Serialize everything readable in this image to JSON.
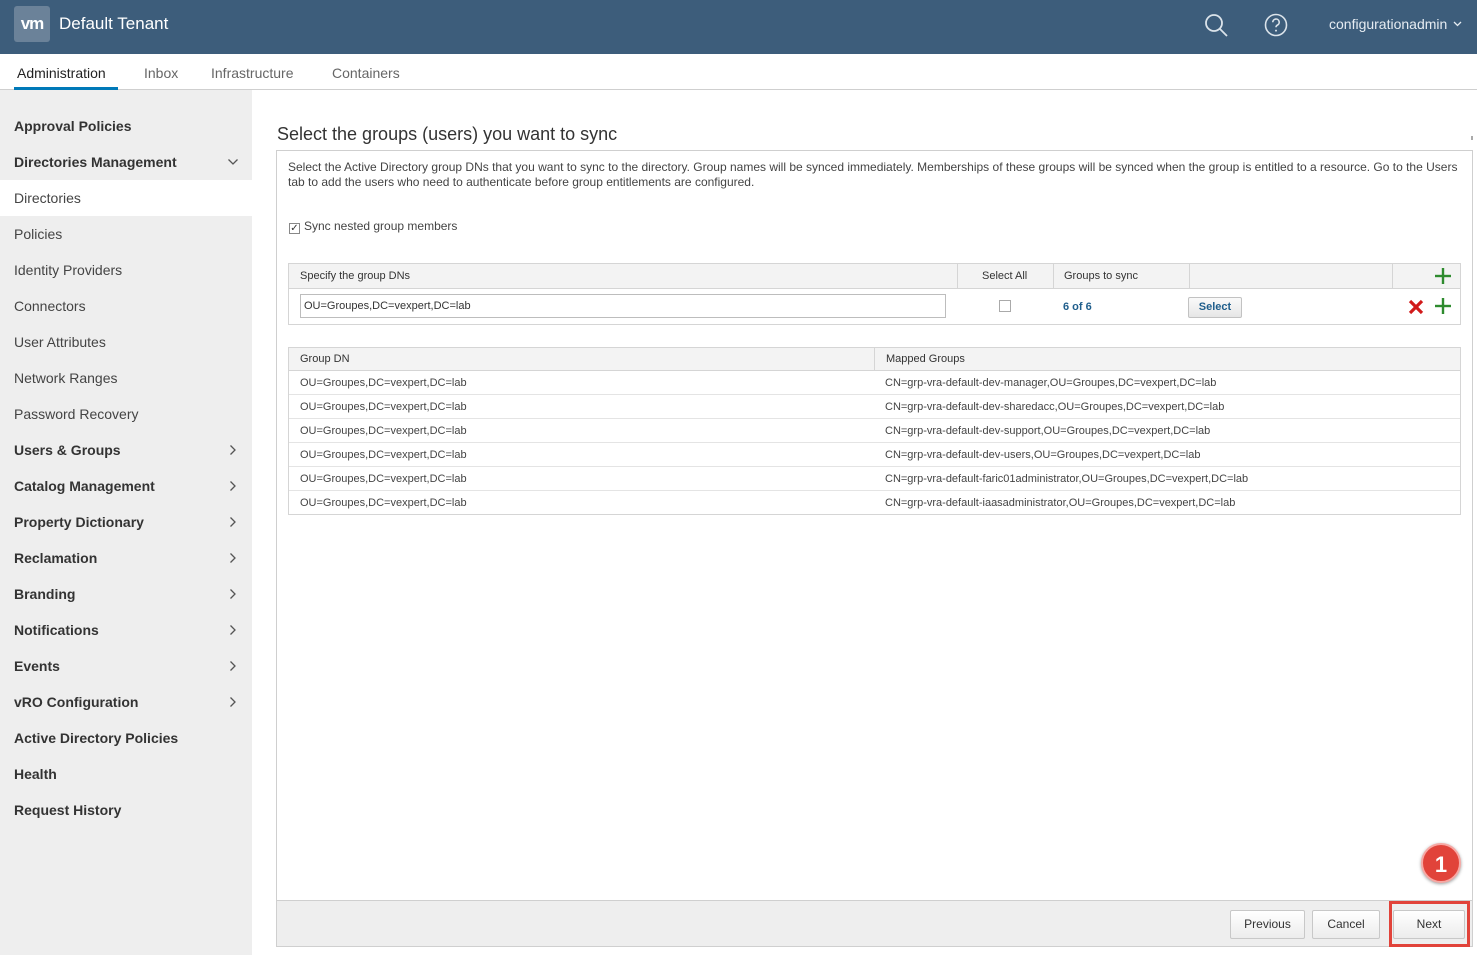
{
  "header": {
    "logo_text": "vm",
    "tenant": "Default Tenant",
    "user": "configurationadmin",
    "icons": [
      "search-icon",
      "help-icon",
      "chevron-down-icon"
    ]
  },
  "tabs": [
    {
      "label": "Administration",
      "active": true
    },
    {
      "label": "Inbox"
    },
    {
      "label": "Infrastructure"
    },
    {
      "label": "Containers"
    }
  ],
  "sidebar": {
    "items": [
      {
        "label": "Approval Policies",
        "bold": true
      },
      {
        "label": "Directories Management",
        "bold": true,
        "expanded": true
      },
      {
        "label": "Directories",
        "selected": true
      },
      {
        "label": "Policies"
      },
      {
        "label": "Identity Providers"
      },
      {
        "label": "Connectors"
      },
      {
        "label": "User Attributes"
      },
      {
        "label": "Network Ranges"
      },
      {
        "label": "Password Recovery"
      },
      {
        "label": "Users & Groups",
        "bold": true
      },
      {
        "label": "Catalog Management",
        "bold": true
      },
      {
        "label": "Property Dictionary",
        "bold": true
      },
      {
        "label": "Reclamation",
        "bold": true
      },
      {
        "label": "Branding",
        "bold": true
      },
      {
        "label": "Notifications",
        "bold": true
      },
      {
        "label": "Events",
        "bold": true
      },
      {
        "label": "vRO Configuration",
        "bold": true
      },
      {
        "label": "Active Directory Policies",
        "bold": true
      },
      {
        "label": "Health",
        "bold": true
      },
      {
        "label": "Request History",
        "bold": true
      }
    ]
  },
  "main": {
    "title": "Select the groups (users) you want to sync",
    "description": "Select the Active Directory group DNs that you want to sync to the directory. Group names will be synced immediately. Memberships of these groups will be synced when the group is entitled to a resource. Go to the Users tab to add the users who need to authenticate before group entitlements are configured.",
    "sync_nested_label": "Sync nested group members",
    "sync_nested_checked": true,
    "dn_table": {
      "col_dn": "Specify the group DNs",
      "col_select_all": "Select All",
      "col_groups": "Groups to sync",
      "dn_value": "OU=Groupes,DC=vexpert,DC=lab",
      "groups_count": "6 of 6",
      "select_label": "Select"
    },
    "mapping_table": {
      "col_group_dn": "Group DN",
      "col_mapped": "Mapped Groups",
      "rows": [
        {
          "dn": "OU=Groupes,DC=vexpert,DC=lab",
          "mapped": "CN=grp-vra-default-dev-manager,OU=Groupes,DC=vexpert,DC=lab"
        },
        {
          "dn": "OU=Groupes,DC=vexpert,DC=lab",
          "mapped": "CN=grp-vra-default-dev-sharedacc,OU=Groupes,DC=vexpert,DC=lab"
        },
        {
          "dn": "OU=Groupes,DC=vexpert,DC=lab",
          "mapped": "CN=grp-vra-default-dev-support,OU=Groupes,DC=vexpert,DC=lab"
        },
        {
          "dn": "OU=Groupes,DC=vexpert,DC=lab",
          "mapped": "CN=grp-vra-default-dev-users,OU=Groupes,DC=vexpert,DC=lab"
        },
        {
          "dn": "OU=Groupes,DC=vexpert,DC=lab",
          "mapped": "CN=grp-vra-default-faric01administrator,OU=Groupes,DC=vexpert,DC=lab"
        },
        {
          "dn": "OU=Groupes,DC=vexpert,DC=lab",
          "mapped": "CN=grp-vra-default-iaasadministrator,OU=Groupes,DC=vexpert,DC=lab"
        }
      ]
    }
  },
  "footer": {
    "previous": "Previous",
    "cancel": "Cancel",
    "next": "Next"
  },
  "annotation": {
    "step": "1",
    "color": "#e1433a"
  },
  "colors": {
    "header_bg": "#3d5d7b",
    "accent": "#0079b8",
    "link": "#1f5e8c",
    "add_green": "#2e8b2e",
    "remove_red": "#d11a1a"
  }
}
